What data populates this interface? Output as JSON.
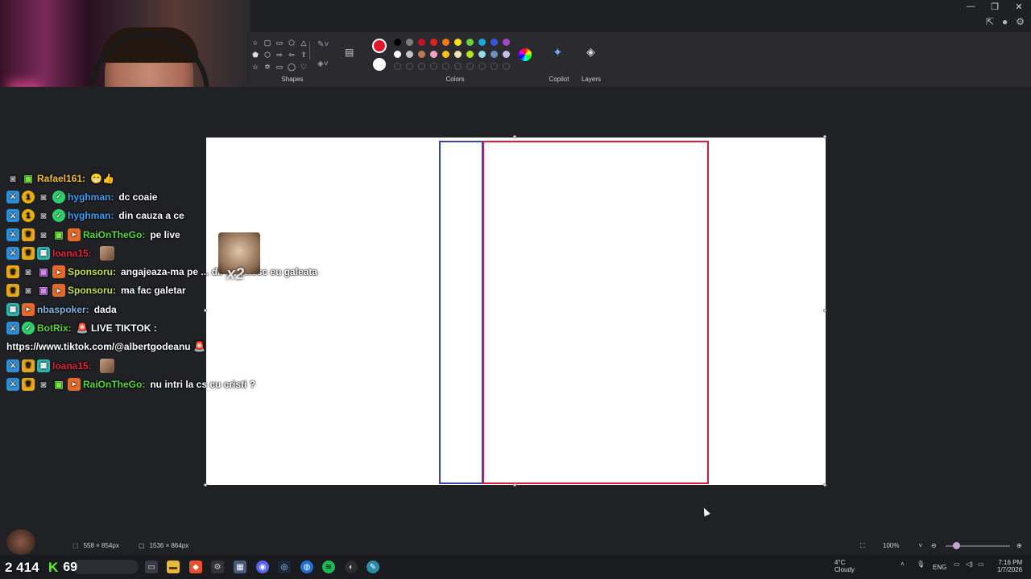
{
  "ribbon": {
    "shapes_label": "Shapes",
    "colors_label": "Colors",
    "copilot_label": "Copilot",
    "layers_label": "Layers",
    "selected_color": "#e0162b",
    "secondary_color": "#ffffff",
    "swatches_row1": [
      "#000000",
      "#7f7f7f",
      "#c8102e",
      "#e02020",
      "#f07a1a",
      "#f5e11d",
      "#6ccf3b",
      "#18a9e0",
      "#3a55d6",
      "#a746c8"
    ],
    "swatches_row2": [
      "#ffffff",
      "#c3c3c3",
      "#b97a57",
      "#f2a5c0",
      "#f7c21b",
      "#efe4b0",
      "#b5e61d",
      "#99d9ea",
      "#7092be",
      "#c8bfe7"
    ]
  },
  "chat": {
    "messages": [
      {
        "user": "Rafael161:",
        "color": "#f0c232",
        "text": "😁👍",
        "badges": [
          "cam",
          "gift"
        ]
      },
      {
        "user": "hyghman:",
        "color": "#3aa0ff",
        "text": "dc coaie",
        "badges": [
          "sword",
          "one",
          "cam",
          "ok"
        ]
      },
      {
        "user": "hyghman:",
        "color": "#3aa0ff",
        "text": "din cauza a ce",
        "badges": [
          "sword",
          "one",
          "cam",
          "ok"
        ]
      },
      {
        "user": "RaiOnTheGo:",
        "color": "#5ad63a",
        "text": "pe live",
        "badges": [
          "sword",
          "crown",
          "cam",
          "gift",
          "yt"
        ]
      },
      {
        "user": "Ioana15:",
        "color": "#e0253a",
        "text": "",
        "badges": [
          "sword",
          "crown",
          "grid"
        ]
      },
      {
        "user": "Sponsoru:",
        "color": "#c3e04a",
        "text": "angajeaza-ma pe ... di. iti golesc eu galeata",
        "badges": [
          "crown",
          "cam",
          "gift2",
          "yt"
        ]
      },
      {
        "user": "Sponsoru:",
        "color": "#c3e04a",
        "text": "ma fac galetar",
        "badges": [
          "crown",
          "cam",
          "gift2",
          "yt"
        ]
      },
      {
        "user": "nbaspoker:",
        "color": "#7fb5e8",
        "text": "dada",
        "badges": [
          "grid",
          "yt"
        ]
      },
      {
        "user": "BotRix:",
        "color": "#5ad63a",
        "text": "🚨 LIVE TIKTOK :",
        "badges": [
          "sword",
          "ok"
        ]
      },
      {
        "user": "",
        "color": "#ffffff",
        "text": "https://www.tiktok.com/@albertgodeanu 🚨",
        "badges": []
      },
      {
        "user": "Ioana15:",
        "color": "#e0253a",
        "text": "",
        "badges": [
          "sword",
          "crown",
          "grid"
        ]
      },
      {
        "user": "RaiOnTheGo:",
        "color": "#5ad63a",
        "text": "nu intri la cs cu cristi ?",
        "badges": [
          "sword",
          "crown",
          "cam",
          "gift",
          "yt"
        ]
      }
    ],
    "emote_multiplier": "x2"
  },
  "status": {
    "selection_size": "558 × 854px",
    "canvas_size": "1536 × 864px",
    "zoom": "100%",
    "zoom_level": 0.1
  },
  "stream": {
    "viewers": "2 414",
    "kick_count": "69"
  },
  "taskbar": {
    "weather_temp": "4°C",
    "weather_desc": "Cloudy",
    "lang": "ENG",
    "time": "7:16 PM",
    "date": "1/7/2026"
  }
}
